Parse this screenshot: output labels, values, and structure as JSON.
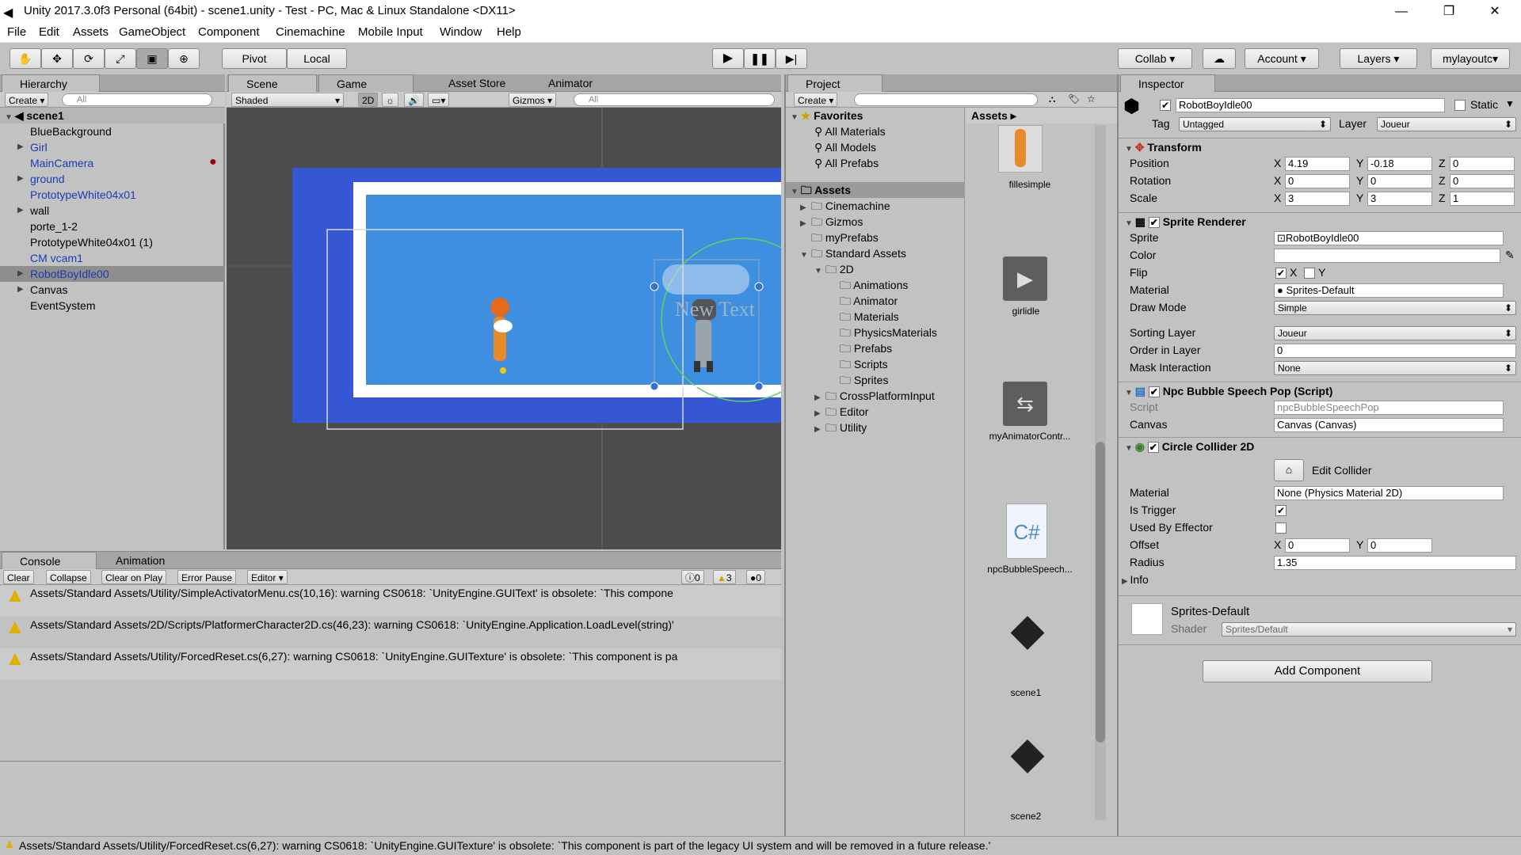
{
  "window": {
    "title": "Unity 2017.3.0f3 Personal (64bit) - scene1.unity - Test - PC, Mac & Linux Standalone <DX11>",
    "minimize": "—",
    "restore": "❐",
    "close": "✕"
  },
  "menu": [
    "File",
    "Edit",
    "Assets",
    "GameObject",
    "Component",
    "Cinemachine",
    "Mobile Input",
    "Window",
    "Help"
  ],
  "toolbar": {
    "pivot": "Pivot",
    "local": "Local",
    "collab": "Collab",
    "account": "Account",
    "layers": "Layers",
    "layout": "mylayoutc"
  },
  "hierarchy": {
    "tab": "Hierarchy",
    "create": "Create",
    "search": "All",
    "scene": "scene1",
    "items": [
      {
        "label": "BlueBackground",
        "blue": false,
        "arrow": false
      },
      {
        "label": "Girl",
        "blue": true,
        "arrow": true
      },
      {
        "label": "MainCamera",
        "blue": true,
        "arrow": false
      },
      {
        "label": "ground",
        "blue": true,
        "arrow": true
      },
      {
        "label": "PrototypeWhite04x01",
        "blue": true,
        "arrow": false
      },
      {
        "label": "wall",
        "blue": false,
        "arrow": true
      },
      {
        "label": "porte_1-2",
        "blue": false,
        "arrow": false
      },
      {
        "label": "PrototypeWhite04x01 (1)",
        "blue": false,
        "arrow": false
      },
      {
        "label": "CM vcam1",
        "blue": true,
        "arrow": false
      },
      {
        "label": "RobotBoyIdle00",
        "blue": true,
        "arrow": true
      },
      {
        "label": "Canvas",
        "blue": false,
        "arrow": true
      },
      {
        "label": "EventSystem",
        "blue": false,
        "arrow": false
      }
    ]
  },
  "scene": {
    "tabs": [
      "Scene",
      "Game",
      "Asset Store",
      "Animator"
    ],
    "shaded": "Shaded",
    "mode2d": "2D",
    "gizmos": "Gizmos",
    "search": "All",
    "bubble_text": "New Text"
  },
  "console": {
    "tabs": [
      "Console",
      "Animation"
    ],
    "clear": "Clear",
    "collapse": "Collapse",
    "clear_on_play": "Clear on Play",
    "error_pause": "Error Pause",
    "editor": "Editor",
    "counts": {
      "info": "0",
      "warn": "3",
      "error": "0"
    },
    "messages": [
      "Assets/Standard Assets/Utility/SimpleActivatorMenu.cs(10,16): warning CS0618: `UnityEngine.GUIText' is obsolete: `This compone",
      "Assets/Standard Assets/2D/Scripts/PlatformerCharacter2D.cs(46,23): warning CS0618: `UnityEngine.Application.LoadLevel(string)'",
      "Assets/Standard Assets/Utility/ForcedReset.cs(6,27): warning CS0618: `UnityEngine.GUITexture' is obsolete: `This component is pa"
    ],
    "status": "Assets/Standard Assets/Utility/ForcedReset.cs(6,27): warning CS0618: `UnityEngine.GUITexture' is obsolete: `This component is part of the legacy UI system and will be removed in a future release.'"
  },
  "project": {
    "tab": "Project",
    "create": "Create",
    "favorites": {
      "label": "Favorites",
      "items": [
        "All Materials",
        "All Models",
        "All Prefabs"
      ]
    },
    "assets_label": "Assets",
    "tree": [
      {
        "label": "Cinemachine",
        "indent": 1,
        "arrow": "▶"
      },
      {
        "label": "Gizmos",
        "indent": 1,
        "arrow": "▶"
      },
      {
        "label": "myPrefabs",
        "indent": 1,
        "arrow": ""
      },
      {
        "label": "Standard Assets",
        "indent": 1,
        "arrow": "▼"
      },
      {
        "label": "2D",
        "indent": 2,
        "arrow": "▼"
      },
      {
        "label": "Animations",
        "indent": 3,
        "arrow": ""
      },
      {
        "label": "Animator",
        "indent": 3,
        "arrow": ""
      },
      {
        "label": "Materials",
        "indent": 3,
        "arrow": ""
      },
      {
        "label": "PhysicsMaterials",
        "indent": 3,
        "arrow": ""
      },
      {
        "label": "Prefabs",
        "indent": 3,
        "arrow": ""
      },
      {
        "label": "Scripts",
        "indent": 3,
        "arrow": ""
      },
      {
        "label": "Sprites",
        "indent": 3,
        "arrow": ""
      },
      {
        "label": "CrossPlatformInput",
        "indent": 2,
        "arrow": "▶"
      },
      {
        "label": "Editor",
        "indent": 2,
        "arrow": "▶"
      },
      {
        "label": "Utility",
        "indent": 2,
        "arrow": "▶"
      }
    ],
    "breadcrumb": "Assets ▸",
    "grid": [
      "fillesimple",
      "girlidle",
      "myAnimatorContr...",
      "npcBubbleSpeech...",
      "scene1",
      "scene2"
    ]
  },
  "inspector": {
    "tab": "Inspector",
    "object_name": "RobotBoyIdle00",
    "static": "Static",
    "tag_label": "Tag",
    "tag": "Untagged",
    "layer_label": "Layer",
    "layer": "Joueur",
    "transform": {
      "title": "Transform",
      "position": {
        "label": "Position",
        "x": "4.19",
        "y": "-0.18",
        "z": "0"
      },
      "rotation": {
        "label": "Rotation",
        "x": "0",
        "y": "0",
        "z": "0"
      },
      "scale": {
        "label": "Scale",
        "x": "3",
        "y": "3",
        "z": "1"
      }
    },
    "sprite_renderer": {
      "title": "Sprite Renderer",
      "sprite_label": "Sprite",
      "sprite": "RobotBoyIdle00",
      "color_label": "Color",
      "flip_label": "Flip",
      "flip_x": "X",
      "flip_y": "Y",
      "material_label": "Material",
      "material": "Sprites-Default",
      "draw_mode_label": "Draw Mode",
      "draw_mode": "Simple",
      "sorting_layer_label": "Sorting Layer",
      "sorting_layer": "Joueur",
      "order_label": "Order in Layer",
      "order": "0",
      "mask_label": "Mask Interaction",
      "mask": "None"
    },
    "npc_script": {
      "title": "Npc Bubble Speech Pop (Script)",
      "script_label": "Script",
      "script": "npcBubbleSpeechPop",
      "canvas_label": "Canvas",
      "canvas": "Canvas (Canvas)"
    },
    "circle_collider": {
      "title": "Circle Collider 2D",
      "edit": "Edit Collider",
      "material_label": "Material",
      "material": "None (Physics Material 2D)",
      "trigger_label": "Is Trigger",
      "effector_label": "Used By Effector",
      "offset_label": "Offset",
      "offset_x": "0",
      "offset_y": "0",
      "radius_label": "Radius",
      "radius": "1.35",
      "info_label": "Info"
    },
    "material_preview": {
      "name": "Sprites-Default",
      "shader_label": "Shader",
      "shader": "Sprites/Default"
    },
    "add_component": "Add Component"
  }
}
